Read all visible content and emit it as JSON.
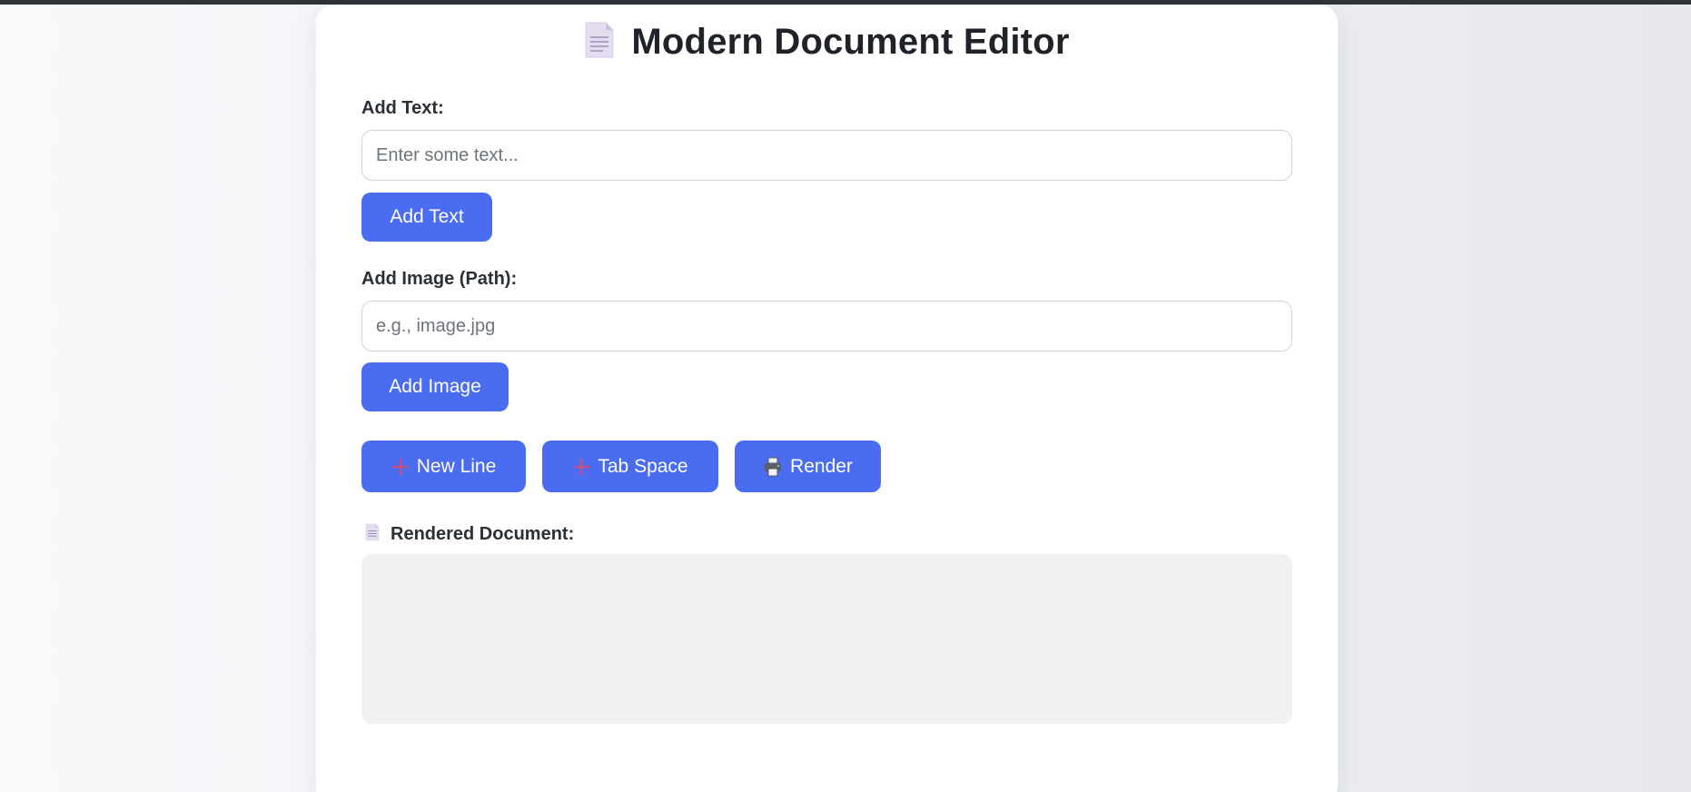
{
  "header": {
    "title": "Modern Document Editor",
    "title_icon": "document-icon"
  },
  "add_text": {
    "label": "Add Text:",
    "input_value": "",
    "placeholder": "Enter some text...",
    "button_label": "Add Text"
  },
  "add_image": {
    "label": "Add Image (Path):",
    "input_value": "",
    "placeholder": "e.g., image.jpg",
    "button_label": "Add Image"
  },
  "actions": {
    "new_line_label": "New Line",
    "new_line_icon": "plus-icon",
    "tab_space_label": "Tab Space",
    "tab_space_icon": "plus-icon",
    "render_label": "Render",
    "render_icon": "printer-icon"
  },
  "rendered": {
    "label": "Rendered Document:",
    "label_icon": "document-icon",
    "content": ""
  },
  "colors": {
    "accent": "#4a6cf0",
    "output_background": "#f0f1f3",
    "top_strip": "#2f3437"
  }
}
